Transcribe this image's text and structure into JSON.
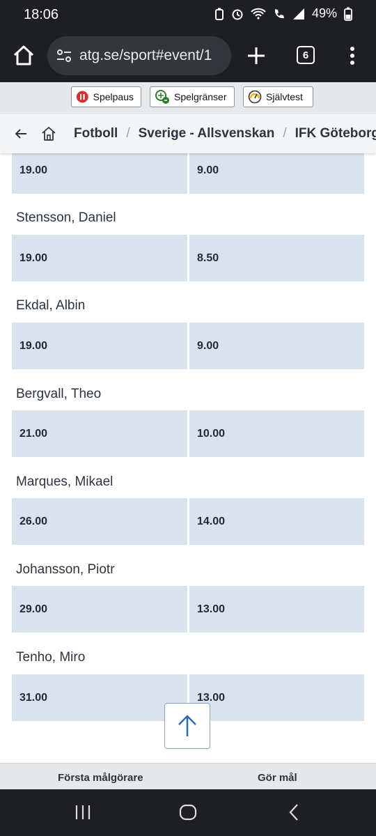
{
  "status": {
    "time": "18:06",
    "battery": "49%"
  },
  "browser": {
    "url": "atg.se/sport#event/1",
    "tab_count": "6"
  },
  "rg": {
    "spelpaus": "Spelpaus",
    "spelgranser": "Spelgränser",
    "sjalvtest": "Självtest"
  },
  "breadcrumb": {
    "items": [
      "Fotboll",
      "Sverige - Allsvenskan",
      "IFK Göteborg -"
    ]
  },
  "players": [
    {
      "name": "",
      "odds1": "19.00",
      "odds2": "9.00"
    },
    {
      "name": "Stensson, Daniel",
      "odds1": "19.00",
      "odds2": "8.50"
    },
    {
      "name": "Ekdal, Albin",
      "odds1": "19.00",
      "odds2": "9.00"
    },
    {
      "name": "Bergvall, Theo",
      "odds1": "21.00",
      "odds2": "10.00"
    },
    {
      "name": "Marques, Mikael",
      "odds1": "26.00",
      "odds2": "14.00"
    },
    {
      "name": "Johansson, Piotr",
      "odds1": "29.00",
      "odds2": "13.00"
    },
    {
      "name": "Tenho, Miro",
      "odds1": "31.00",
      "odds2": "13.00"
    }
  ],
  "bottom_tabs": [
    "Första målgörare",
    "Gör mål"
  ],
  "colors": {
    "odds_bg": "#d9e3ee",
    "chrome_bg": "#1e1f22",
    "accent": "#2b6cb0"
  }
}
